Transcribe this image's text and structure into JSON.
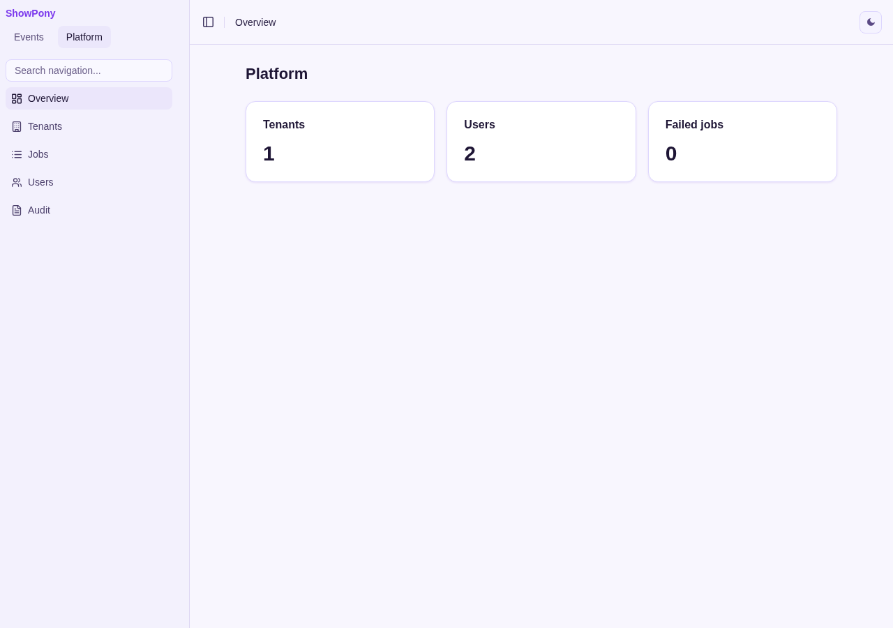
{
  "sidebar": {
    "brand": "ShowPony",
    "tabs": [
      {
        "label": "Events",
        "selected": false
      },
      {
        "label": "Platform",
        "selected": true
      }
    ],
    "search": {
      "placeholder": "Search navigation..."
    },
    "items": [
      {
        "label": "Overview",
        "selected": true
      },
      {
        "label": "Tenants",
        "selected": false
      },
      {
        "label": "Jobs",
        "selected": false
      },
      {
        "label": "Users",
        "selected": false
      },
      {
        "label": "Audit",
        "selected": false
      }
    ]
  },
  "header": {
    "breadcrumb": "Overview"
  },
  "page": {
    "title": "Platform",
    "stats": [
      {
        "label": "Tenants",
        "value": "1"
      },
      {
        "label": "Users",
        "value": "2"
      },
      {
        "label": "Failed jobs",
        "value": "0"
      }
    ]
  }
}
